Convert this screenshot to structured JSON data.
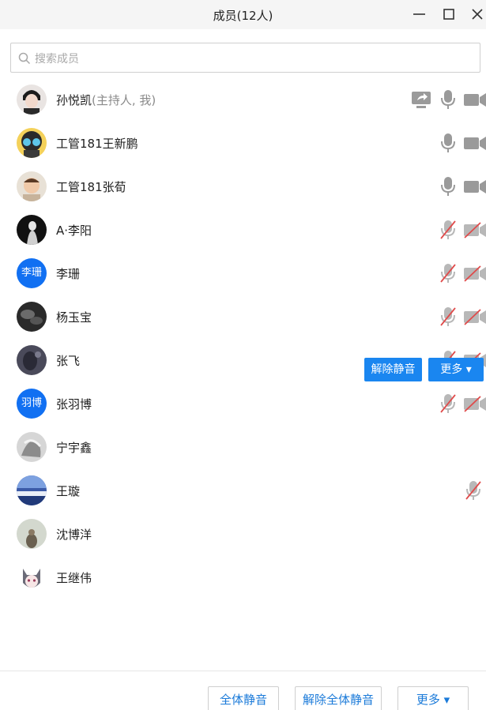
{
  "window": {
    "title": "成员(12人)"
  },
  "search": {
    "placeholder": "搜索成员"
  },
  "members": [
    {
      "name": "孙悦凯",
      "suffix": "(主持人, 我)"
    },
    {
      "name": "工管181王新鹏"
    },
    {
      "name": "工管181张荀"
    },
    {
      "name": "A·李阳"
    },
    {
      "name": "李珊",
      "avatar_text": "李珊"
    },
    {
      "name": "杨玉宝"
    },
    {
      "name": "张飞"
    },
    {
      "name": "张羽博",
      "avatar_text": "羽博"
    },
    {
      "name": "宁宇鑫"
    },
    {
      "name": "王璇"
    },
    {
      "name": "沈博洋"
    },
    {
      "name": "王继伟"
    }
  ],
  "row_actions": {
    "unmute_label": "解除静音",
    "more_label": "更多 ▾"
  },
  "footer": {
    "mute_all_label": "全体静音",
    "unmute_all_label": "解除全体静音",
    "more_label": "更多 ▾"
  },
  "colors": {
    "accent": "#1a86f0",
    "avatar_blue": "#1170f2",
    "muted_slash": "#e04b4b"
  }
}
